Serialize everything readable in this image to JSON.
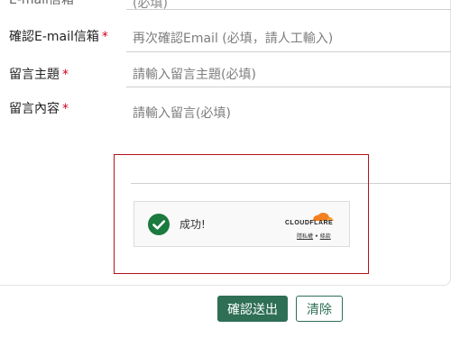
{
  "form": {
    "top_clipped_label": "E-mail信箱",
    "top_clipped_value": "(必填)",
    "confirm_email": {
      "label": "確認E-mail信箱",
      "required_mark": "*",
      "placeholder": "再次確認Email (必填，請人工輸入)"
    },
    "subject": {
      "label": "留言主題",
      "required_mark": "*",
      "placeholder": "請輸入留言主題(必填)"
    },
    "content": {
      "label": "留言內容",
      "required_mark": "*",
      "placeholder": "請輸入留言(必填)"
    }
  },
  "captcha": {
    "status_text": "成功!",
    "brand": "CLOUDFLARE",
    "privacy_link": "隱私權",
    "separator": "•",
    "terms_link": "條款",
    "check_color": "#1b7a3e",
    "frame_color": "#b3121b",
    "brand_color": "#f38020"
  },
  "actions": {
    "submit_label": "確認送出",
    "clear_label": "清除",
    "accent_color": "#2e6f56"
  }
}
